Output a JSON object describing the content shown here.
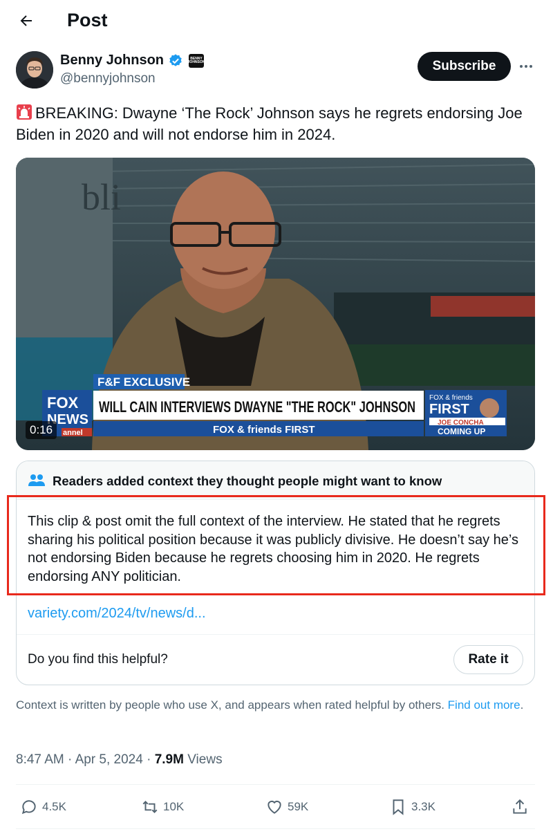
{
  "header": {
    "title": "Post"
  },
  "author": {
    "name": "Benny Johnson",
    "handle": "@bennyjohnson",
    "badge_text": "BENNY JOHNSON",
    "verified_color": "#1d9bf0"
  },
  "subscribe_label": "Subscribe",
  "tweet": {
    "text": "BREAKING: Dwayne ‘The Rock’ Johnson says he regrets endorsing Joe Biden in 2020 and will not endorse him in 2024.",
    "emoji": "rotating-light-icon"
  },
  "video": {
    "duration": "0:16",
    "chyron_tag": "F&F EXCLUSIVE",
    "chyron_headline": "WILL CAIN INTERVIEWS DWAYNE \"THE ROCK\" JOHNSON",
    "chyron_show": "FOX & friends FIRST",
    "logo_line1": "FOX",
    "logo_line2": "NEWS",
    "logo_line3": "annel",
    "promo_show_top": "FOX & friends",
    "promo_show_big": "FIRST",
    "promo_name": "JOE CONCHA",
    "promo_coming": "COMING UP",
    "bg_sign": "bli"
  },
  "community_note": {
    "title": "Readers added context they thought people might want to know",
    "body": "This clip & post omit the full context of the interview. He stated that he regrets sharing his political position because it was publicly divisive. He doesn’t say he’s not endorsing Biden because he regrets choosing him in 2020. He regrets endorsing ANY politician.",
    "link": "variety.com/2024/tv/news/d...",
    "helpful_question": "Do you find this helpful?",
    "rate_label": "Rate it"
  },
  "context_footer": {
    "text": "Context is written by people who use X, and appears when rated helpful by others.",
    "link_text": "Find out more",
    "period": "."
  },
  "meta": {
    "time": "8:47 AM",
    "sep1": " · ",
    "date": "Apr 5, 2024",
    "sep2": " · ",
    "views_count": "7.9M",
    "views_label": " Views"
  },
  "actions": {
    "replies": "4.5K",
    "reposts": "10K",
    "likes": "59K",
    "bookmarks": "3.3K"
  },
  "colors": {
    "accent": "#1d9bf0",
    "highlight": "#e8291c",
    "text_secondary": "#536471"
  }
}
